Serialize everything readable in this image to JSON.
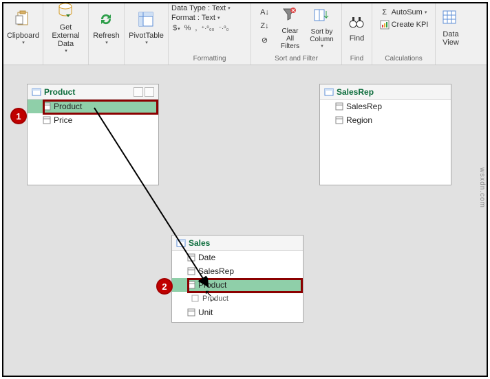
{
  "ribbon": {
    "clipboard": {
      "label": "Clipboard"
    },
    "getdata": {
      "label": "Get External\nData"
    },
    "refresh": {
      "label": "Refresh"
    },
    "pivot": {
      "label": "PivotTable"
    },
    "formatting": {
      "group_label": "Formatting",
      "datatype_label": "Data Type : Text",
      "format_label": "Format : Text",
      "icons": {
        "dollar": "$",
        "percent": "%",
        "comma": ",",
        "inc": ".00",
        "dec": ".0"
      }
    },
    "sortfilter": {
      "group_label": "Sort and Filter",
      "sort_az": "A↓Z",
      "sort_za": "Z↓A",
      "clearsort": "⨂",
      "clearfilters": "Clear All Filters",
      "sortbycol": "Sort by Column"
    },
    "find": {
      "group_label": "Find",
      "label": "Find"
    },
    "calc": {
      "group_label": "Calculations",
      "autosum": "AutoSum",
      "createkpi": "Create KPI"
    },
    "view": {
      "label": "Data\nView"
    }
  },
  "tables": {
    "product": {
      "title": "Product",
      "fields": {
        "product": "Product",
        "price": "Price"
      }
    },
    "salesrep": {
      "title": "SalesRep",
      "fields": {
        "salesrep": "SalesRep",
        "region": "Region"
      }
    },
    "sales": {
      "title": "Sales",
      "fields": {
        "date": "Date",
        "salesrep": "SalesRep",
        "product": "Product",
        "dragghost": "Product",
        "unit": "Unit"
      }
    }
  },
  "annotations": {
    "badge1": "1",
    "badge2": "2"
  },
  "watermark": "wsxdn.com"
}
